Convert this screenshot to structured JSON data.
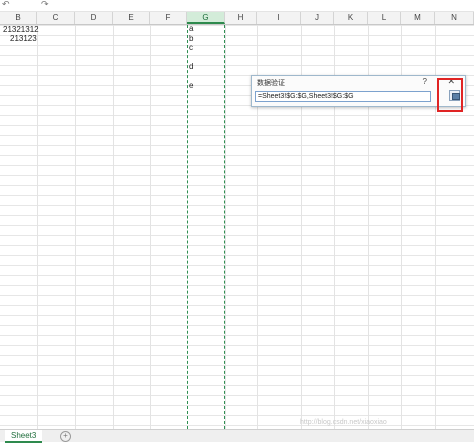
{
  "toolbar": {
    "undo_icon": "↶",
    "redo_icon": "↷"
  },
  "columns": [
    "B",
    "C",
    "D",
    "E",
    "F",
    "G",
    "H",
    "I",
    "J",
    "K",
    "L",
    "M",
    "N"
  ],
  "selected_column": "G",
  "cells": {
    "b1": "21321312",
    "b2": "213123",
    "g_values": [
      "a",
      "b",
      "c",
      "d",
      "e"
    ]
  },
  "dialog": {
    "title": "数据验证",
    "help": "?",
    "close": "✕",
    "input_value": "=Sheet3!$G:$G,Sheet3!$G:$G"
  },
  "sheet_tabs": [
    "Sheet3"
  ],
  "add_sheet": "+",
  "watermark": "http://blog.csdn.net/xiaoxiao"
}
